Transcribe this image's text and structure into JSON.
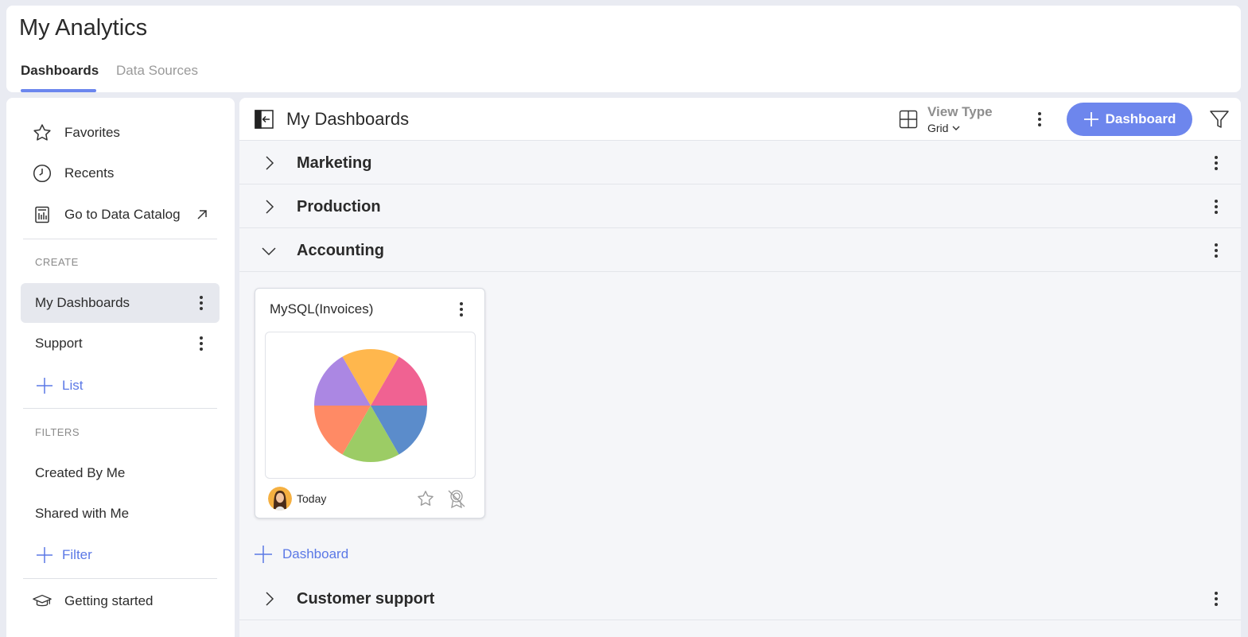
{
  "app": {
    "title": "My Analytics",
    "tabs": [
      {
        "label": "Dashboards",
        "active": true
      },
      {
        "label": "Data Sources",
        "active": false
      }
    ]
  },
  "sidebar": {
    "top_items": [
      {
        "label": "Favorites",
        "icon": "star-icon"
      },
      {
        "label": "Recents",
        "icon": "clock-icon"
      },
      {
        "label": "Go to Data Catalog",
        "icon": "catalog-icon"
      }
    ],
    "create_section": {
      "label": "CREATE",
      "lists": [
        {
          "label": "My Dashboards",
          "selected": true
        },
        {
          "label": "Support",
          "selected": false
        }
      ],
      "add_label": "List"
    },
    "filters_section": {
      "label": "FILTERS",
      "items": [
        {
          "label": "Created By Me"
        },
        {
          "label": "Shared with Me"
        }
      ],
      "add_label": "Filter"
    },
    "bottom_item": {
      "label": "Getting started",
      "icon": "graduation-cap-icon"
    }
  },
  "main": {
    "title": "My Dashboards",
    "view_type": {
      "label": "View Type",
      "value": "Grid"
    },
    "add_button_label": "Dashboard",
    "groups": [
      {
        "label": "Marketing",
        "expanded": false
      },
      {
        "label": "Production",
        "expanded": false
      },
      {
        "label": "Accounting",
        "expanded": true
      },
      {
        "label": "Customer support",
        "expanded": false
      }
    ],
    "accounting_dashboards": [
      {
        "title": "MySQL(Invoices)",
        "modified": "Today"
      }
    ],
    "add_dashboard_label": "Dashboard"
  },
  "colors": {
    "accent": "#6d86ed",
    "link": "#5b78e6",
    "pie": [
      "#f06292",
      "#5b8ccb",
      "#9ccc65",
      "#ff8a65",
      "#ab87e3",
      "#ffb74d"
    ]
  }
}
